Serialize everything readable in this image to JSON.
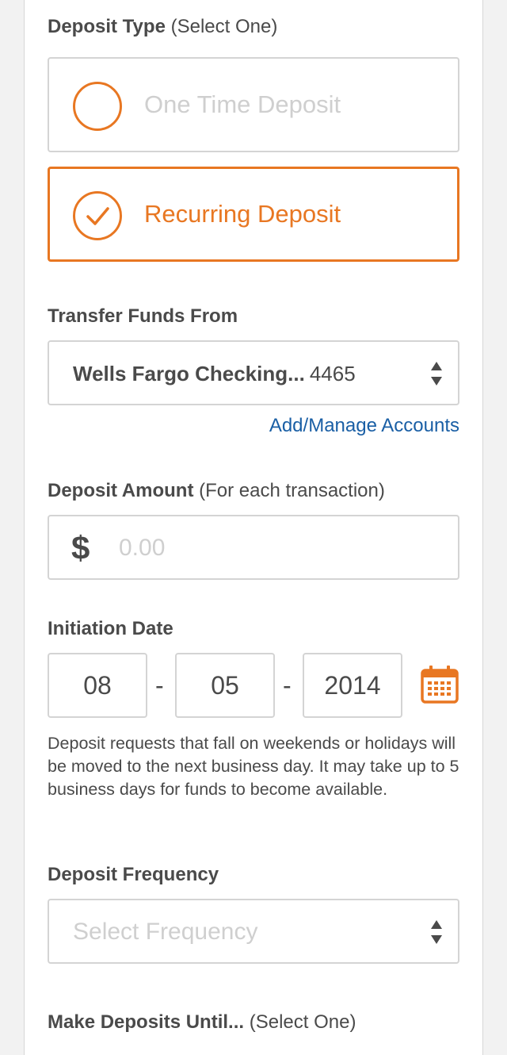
{
  "deposit_type": {
    "label": "Deposit Type",
    "sub_label": "(Select One)",
    "options": [
      {
        "label": "One Time Deposit",
        "selected": false
      },
      {
        "label": "Recurring Deposit",
        "selected": true
      }
    ]
  },
  "transfer_from": {
    "label": "Transfer Funds From",
    "account_name": "Wells Fargo Checking...",
    "account_number": "4465",
    "manage_link": "Add/Manage Accounts"
  },
  "deposit_amount": {
    "label": "Deposit Amount",
    "sub_label": "(For each transaction)",
    "currency_symbol": "$",
    "placeholder": "0.00"
  },
  "initiation_date": {
    "label": "Initiation Date",
    "month": "08",
    "day": "05",
    "year": "2014",
    "separator": "-",
    "icon": "calendar-icon"
  },
  "notice": "Deposit requests that fall on weekends or holidays will be moved to the next business day. It may take up to 5 business days for funds to become available.",
  "deposit_frequency": {
    "label": "Deposit Frequency",
    "placeholder": "Select Frequency"
  },
  "make_deposits_until": {
    "label": "Make Deposits Until...",
    "sub_label": "(Select One)"
  },
  "colors": {
    "accent": "#e87722",
    "link": "#1a5fa5",
    "text": "#4a4a4a",
    "placeholder": "#cfcfcf",
    "border": "#d4d4d4"
  }
}
